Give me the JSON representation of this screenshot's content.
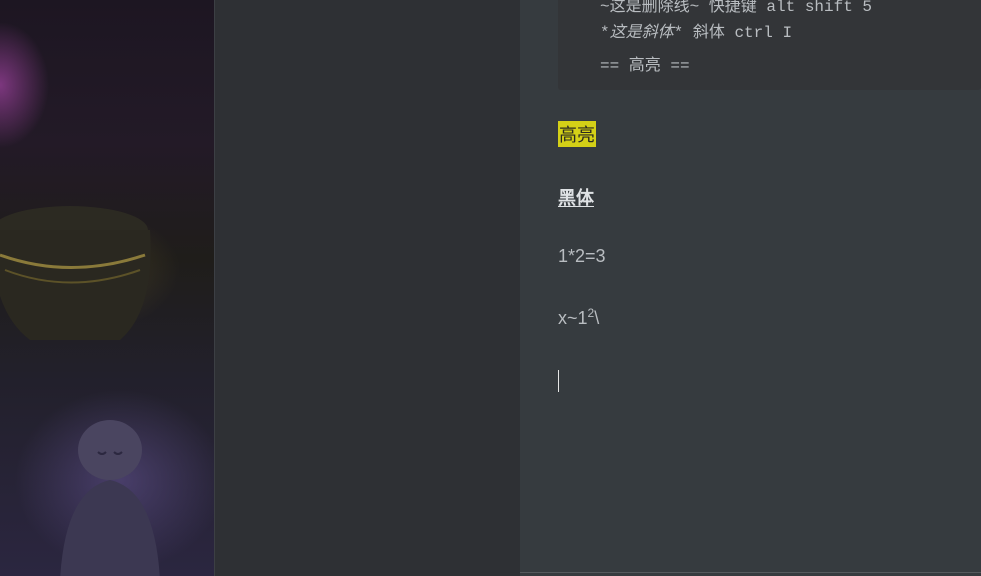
{
  "code_block": {
    "line1": "~这是删除线~ 快捷键 alt shift 5",
    "line2_marker_open": "*",
    "line2_italic": "这是斜体",
    "line2_marker_close": "*",
    "line2_rest": " 斜体 ctrl I",
    "line3": "== 高亮 =="
  },
  "content": {
    "highlight_text": "高亮",
    "bold_text": "黑体",
    "math_text": "1*2=3",
    "sub_text": "x~1",
    "sup_text": "2",
    "sup_tail": "\\"
  },
  "colors": {
    "editor_bg": "#363b3f",
    "highlight_bg": "#d4d017",
    "text": "#b9bdc1"
  }
}
